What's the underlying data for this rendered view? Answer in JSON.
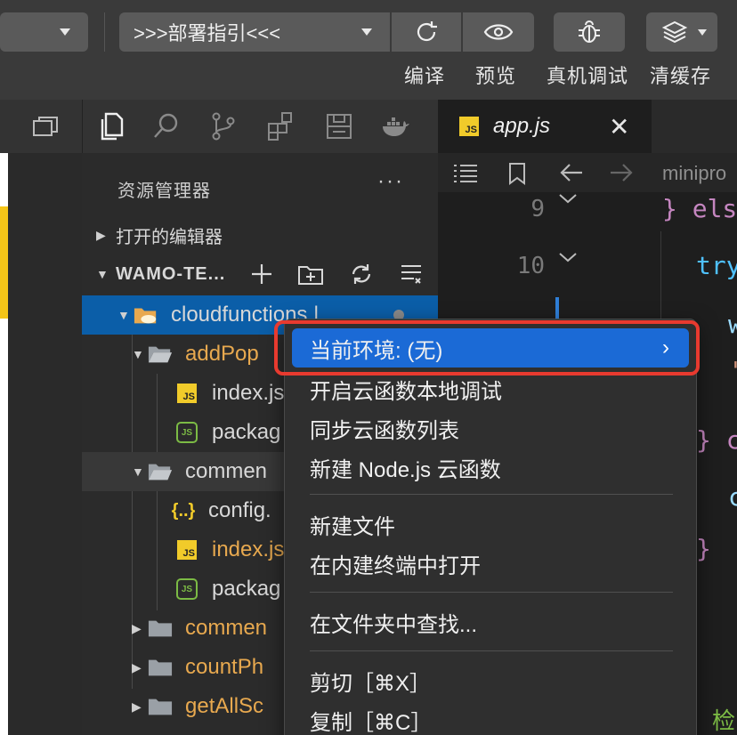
{
  "toolbar": {
    "mode_select": ">>>部署指引<<<",
    "buttons": [
      {
        "label": "编译",
        "icon": "refresh-icon"
      },
      {
        "label": "预览",
        "icon": "eye-icon"
      },
      {
        "label": "真机调试",
        "icon": "bug-icon"
      },
      {
        "label": "清缓存",
        "icon": "layers-icon"
      }
    ]
  },
  "explorer": {
    "title": "资源管理器",
    "more": "···",
    "open_editors": "打开的编辑器",
    "project": "WAMO-TE...",
    "tree": [
      {
        "name": "cloudfunctions |",
        "type": "cloud-folder",
        "expanded": true,
        "selected": true
      },
      {
        "name": "addPop",
        "type": "folder",
        "expanded": true
      },
      {
        "name": "index.js",
        "type": "js"
      },
      {
        "name": "packag",
        "type": "node"
      },
      {
        "name": "commen",
        "type": "folder",
        "expanded": true
      },
      {
        "name": "config.",
        "type": "json"
      },
      {
        "name": "index.js",
        "type": "js"
      },
      {
        "name": "packag",
        "type": "node"
      },
      {
        "name": "commen",
        "type": "folder",
        "expanded": false
      },
      {
        "name": "countPh",
        "type": "folder",
        "expanded": false
      },
      {
        "name": "getAllSc",
        "type": "folder",
        "expanded": false
      }
    ]
  },
  "editor": {
    "tab_title": "app.js",
    "tab_badge": "JS",
    "breadcrumb": "minipro",
    "line_numbers": [
      "9",
      "10"
    ],
    "code": [
      "} els",
      "try",
      "w",
      "'",
      "} c",
      "c",
      "}"
    ]
  },
  "context_menu": {
    "items": [
      {
        "label": "当前环境: (无)",
        "active": true,
        "submenu": "›"
      },
      {
        "label": "开启云函数本地调试"
      },
      {
        "label": "同步云函数列表"
      },
      {
        "label": "新建 Node.js 云函数"
      },
      {
        "label": "新建文件"
      },
      {
        "label": "在内建终端中打开"
      },
      {
        "label": "在文件夹中查找..."
      },
      {
        "label": "剪切［⌘X］"
      },
      {
        "label": "复制［⌘C］"
      }
    ]
  },
  "colors": {
    "selection": "#0b5ea8",
    "menu_active": "#1b6ad6",
    "highlight_box": "#e83a2f",
    "folder": "#e8a94f",
    "js_badge": "#f1cb2a"
  },
  "bottom_right_char": "检"
}
